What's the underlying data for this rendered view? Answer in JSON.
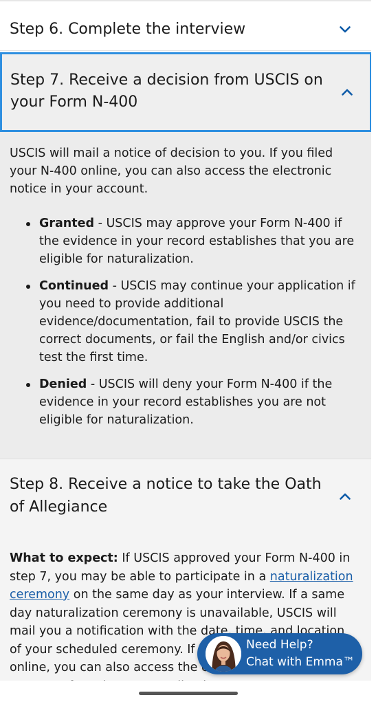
{
  "steps": {
    "step6": {
      "title": "Step 6. Complete the interview",
      "state": "collapsed"
    },
    "step7": {
      "title": "Step 7. Receive a decision from USCIS on your Form N-400",
      "state": "expanded",
      "intro": "USCIS will mail a notice of decision to you. If you filed your N-400 online, you can also access the electronic notice in your account.",
      "items": [
        {
          "term": "Granted",
          "text": " - USCIS may approve your Form N-400 if the evidence in your record establishes that you are eligible for naturalization."
        },
        {
          "term": "Continued",
          "text": " - USCIS may continue your application if you need to provide additional evidence/documentation, fail to provide USCIS the correct documents, or fail the English and/or civics test the first time."
        },
        {
          "term": "Denied",
          "text": " - USCIS will deny your Form N-400 if the evidence in your record establishes you are not eligible for naturalization."
        }
      ]
    },
    "step8": {
      "title": "Step 8. Receive a notice to take the Oath of Allegiance",
      "state": "expanded",
      "expect_label": "What to expect:",
      "text_a": " If USCIS approved your Form N-400 in step 7, you may be able to participate in a ",
      "link": "naturalization ceremony",
      "text_b": " on the same day as your interview. If a same day naturalization ceremony is unavailable, USCIS will mail you a notification with the date, time, and location of your scheduled ceremony. If you filed your Form N-400 online, you can also access the electronic notice in your account. If you have an application"
    }
  },
  "chat": {
    "line1": "Need Help?",
    "line2": "Chat with Emma™",
    "avatar_icon": "emma-avatar-icon"
  },
  "colors": {
    "accent_blue": "#2e8fe0",
    "chevron_blue": "#0e5ba8",
    "chat_blue": "#1e60a8",
    "link_blue": "#1a5ea8"
  }
}
